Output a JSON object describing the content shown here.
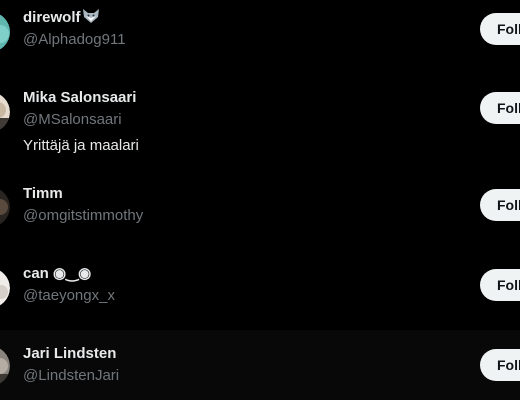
{
  "theme": {
    "background": "#000000",
    "hover_background": "#080808",
    "name_color": "#e7e9ea",
    "handle_color": "#71767b",
    "button_background": "#eff3f4",
    "button_text": "#0f1419"
  },
  "users": [
    {
      "name": "direwolf",
      "name_icon": "wolf-emoji-icon",
      "handle": "@Alphadog911",
      "bio": "",
      "follow_label": "Follow",
      "avatar_color": "#5fb7b0"
    },
    {
      "name": "Mika Salonsaari",
      "handle": "@MSalonsaari",
      "bio": "Yrittäjä ja maalari",
      "follow_label": "Follow",
      "avatar_color": "#d8c9b6"
    },
    {
      "name": "Timm",
      "handle": "@omgitstimmothy",
      "bio": "",
      "follow_label": "Follow",
      "avatar_color": "#3a302a"
    },
    {
      "name": "can ◉‿◉",
      "handle": "@taeyongx_x",
      "bio": "",
      "follow_label": "Follow",
      "avatar_color": "#e8e6e3"
    },
    {
      "name": "Jari Lindsten",
      "handle": "@LindstenJari",
      "bio": "",
      "follow_label": "Follow",
      "avatar_color": "#7a7570"
    }
  ]
}
